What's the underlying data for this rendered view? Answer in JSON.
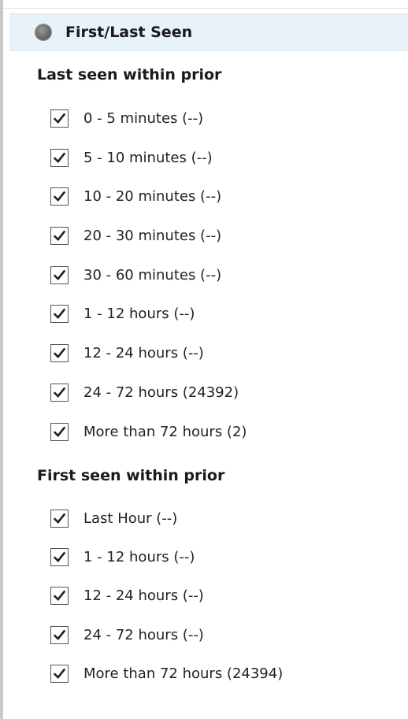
{
  "panel": {
    "title": "First/Last Seen",
    "header_bg": "#e7f2f9",
    "radio_icon": "radio-bullet-icon"
  },
  "last_seen": {
    "heading": "Last seen within prior",
    "options": [
      {
        "label": "0 - 5 minutes (--)",
        "checked": true
      },
      {
        "label": "5 - 10 minutes (--)",
        "checked": true
      },
      {
        "label": "10 - 20 minutes (--)",
        "checked": true
      },
      {
        "label": "20 - 30 minutes (--)",
        "checked": true
      },
      {
        "label": "30 - 60 minutes (--)",
        "checked": true
      },
      {
        "label": "1 - 12 hours (--)",
        "checked": true
      },
      {
        "label": "12 - 24 hours (--)",
        "checked": true
      },
      {
        "label": "24 - 72 hours (24392)",
        "checked": true
      },
      {
        "label": "More than 72 hours (2)",
        "checked": true
      }
    ]
  },
  "first_seen": {
    "heading": "First seen within prior",
    "options": [
      {
        "label": "Last Hour (--)",
        "checked": true
      },
      {
        "label": "1 - 12 hours (--)",
        "checked": true
      },
      {
        "label": "12 - 24 hours (--)",
        "checked": true
      },
      {
        "label": "24 - 72 hours (--)",
        "checked": true
      },
      {
        "label": "More than 72 hours (24394)",
        "checked": true
      }
    ]
  }
}
